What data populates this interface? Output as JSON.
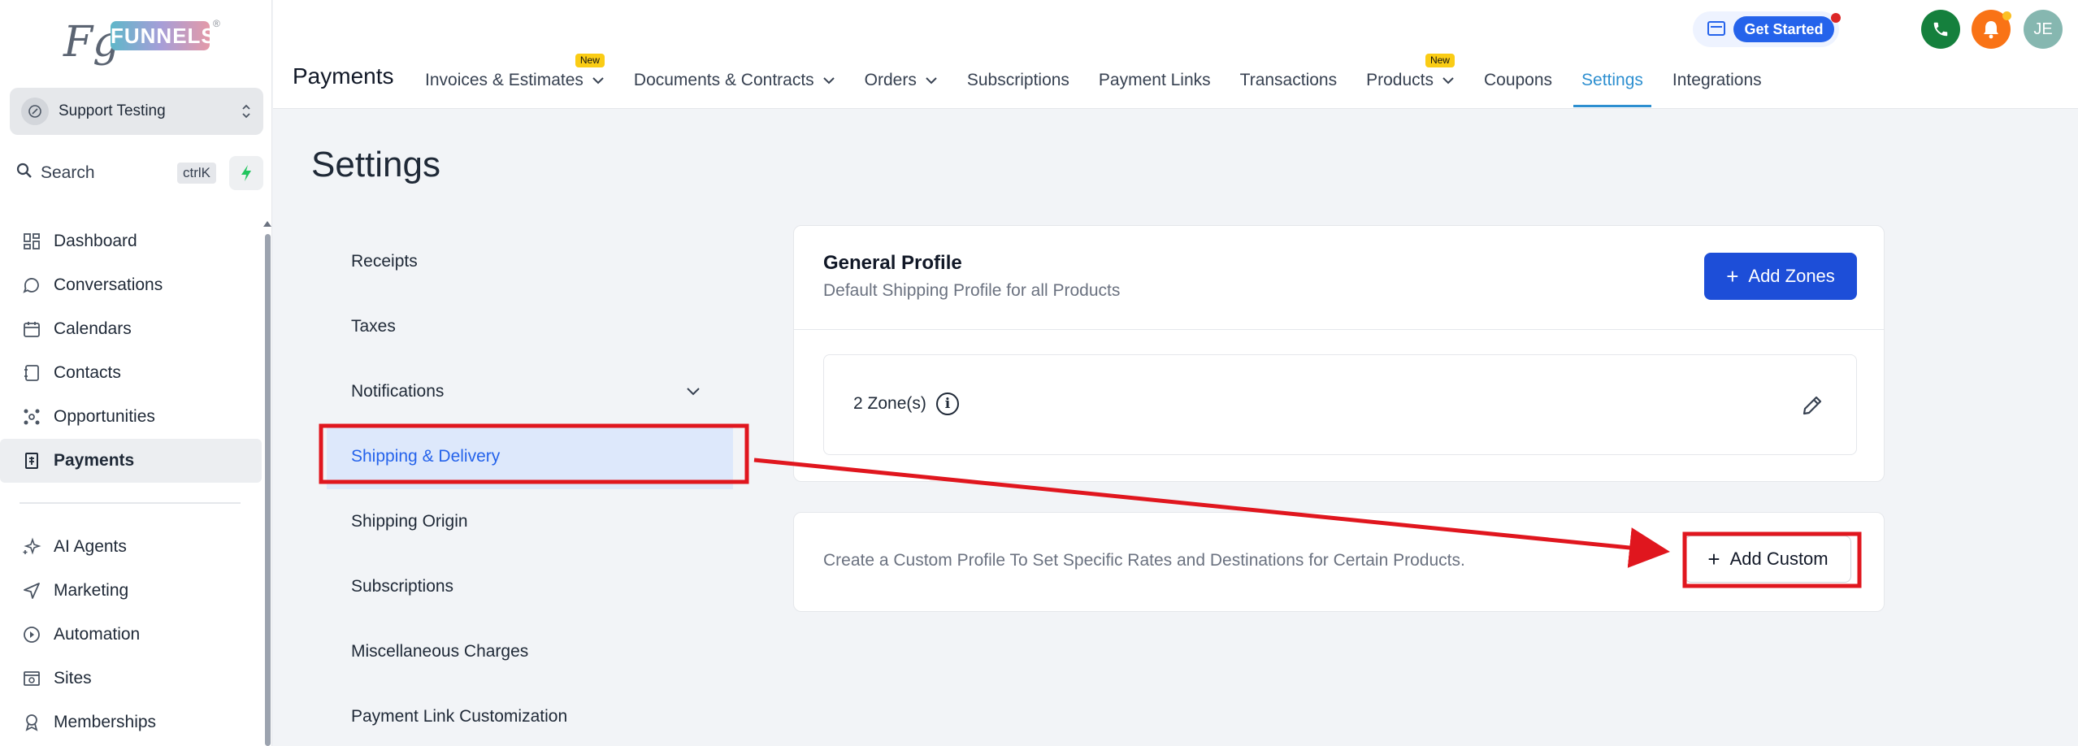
{
  "brand": {
    "logo_mark": "Fg",
    "logo_text": "FUNNELS",
    "registered": "®"
  },
  "account": {
    "name": "Support Testing"
  },
  "search": {
    "label": "Search",
    "shortcut": "ctrlK"
  },
  "sidebar": {
    "items": [
      {
        "label": "Dashboard",
        "icon": "dashboard-icon",
        "active": false
      },
      {
        "label": "Conversations",
        "icon": "chat-icon",
        "active": false
      },
      {
        "label": "Calendars",
        "icon": "calendar-icon",
        "active": false
      },
      {
        "label": "Contacts",
        "icon": "contacts-icon",
        "active": false
      },
      {
        "label": "Opportunities",
        "icon": "opportunities-icon",
        "active": false
      },
      {
        "label": "Payments",
        "icon": "payments-icon",
        "active": true
      }
    ],
    "items2": [
      {
        "label": "AI Agents",
        "icon": "sparkle-icon"
      },
      {
        "label": "Marketing",
        "icon": "send-icon"
      },
      {
        "label": "Automation",
        "icon": "automation-icon"
      },
      {
        "label": "Sites",
        "icon": "sites-icon"
      },
      {
        "label": "Memberships",
        "icon": "memberships-icon"
      }
    ]
  },
  "header": {
    "get_started": "Get Started",
    "user_initials": "JE",
    "section_title": "Payments",
    "tabs": [
      {
        "label": "Invoices & Estimates",
        "dropdown": true,
        "badge": "New",
        "active": false
      },
      {
        "label": "Documents & Contracts",
        "dropdown": true,
        "badge": "",
        "active": false
      },
      {
        "label": "Orders",
        "dropdown": true,
        "badge": "",
        "active": false
      },
      {
        "label": "Subscriptions",
        "dropdown": false,
        "badge": "",
        "active": false
      },
      {
        "label": "Payment Links",
        "dropdown": false,
        "badge": "",
        "active": false
      },
      {
        "label": "Transactions",
        "dropdown": false,
        "badge": "",
        "active": false
      },
      {
        "label": "Products",
        "dropdown": true,
        "badge": "New",
        "active": false
      },
      {
        "label": "Coupons",
        "dropdown": false,
        "badge": "",
        "active": false
      },
      {
        "label": "Settings",
        "dropdown": false,
        "badge": "",
        "active": true
      },
      {
        "label": "Integrations",
        "dropdown": false,
        "badge": "",
        "active": false
      }
    ]
  },
  "main": {
    "title": "Settings",
    "settings_nav": [
      {
        "label": "Receipts",
        "expandable": false,
        "active": false
      },
      {
        "label": "Taxes",
        "expandable": false,
        "active": false
      },
      {
        "label": "Notifications",
        "expandable": true,
        "active": false
      },
      {
        "label": "Shipping & Delivery",
        "expandable": false,
        "active": true
      },
      {
        "label": "Shipping Origin",
        "expandable": false,
        "active": false
      },
      {
        "label": "Subscriptions",
        "expandable": false,
        "active": false
      },
      {
        "label": "Miscellaneous Charges",
        "expandable": false,
        "active": false
      },
      {
        "label": "Payment Link Customization",
        "expandable": false,
        "active": false
      }
    ],
    "general_profile": {
      "title": "General Profile",
      "subtitle": "Default Shipping Profile for all Products",
      "add_zones": "Add Zones",
      "zones": "2 Zone(s)"
    },
    "custom_profile": {
      "text": "Create a Custom Profile To Set Specific Rates and Destinations for Certain Products.",
      "add_custom": "Add Custom"
    }
  },
  "colors": {
    "accent": "#2563eb",
    "tab_active": "#2d8fd0",
    "annotation": "#e0161e"
  }
}
